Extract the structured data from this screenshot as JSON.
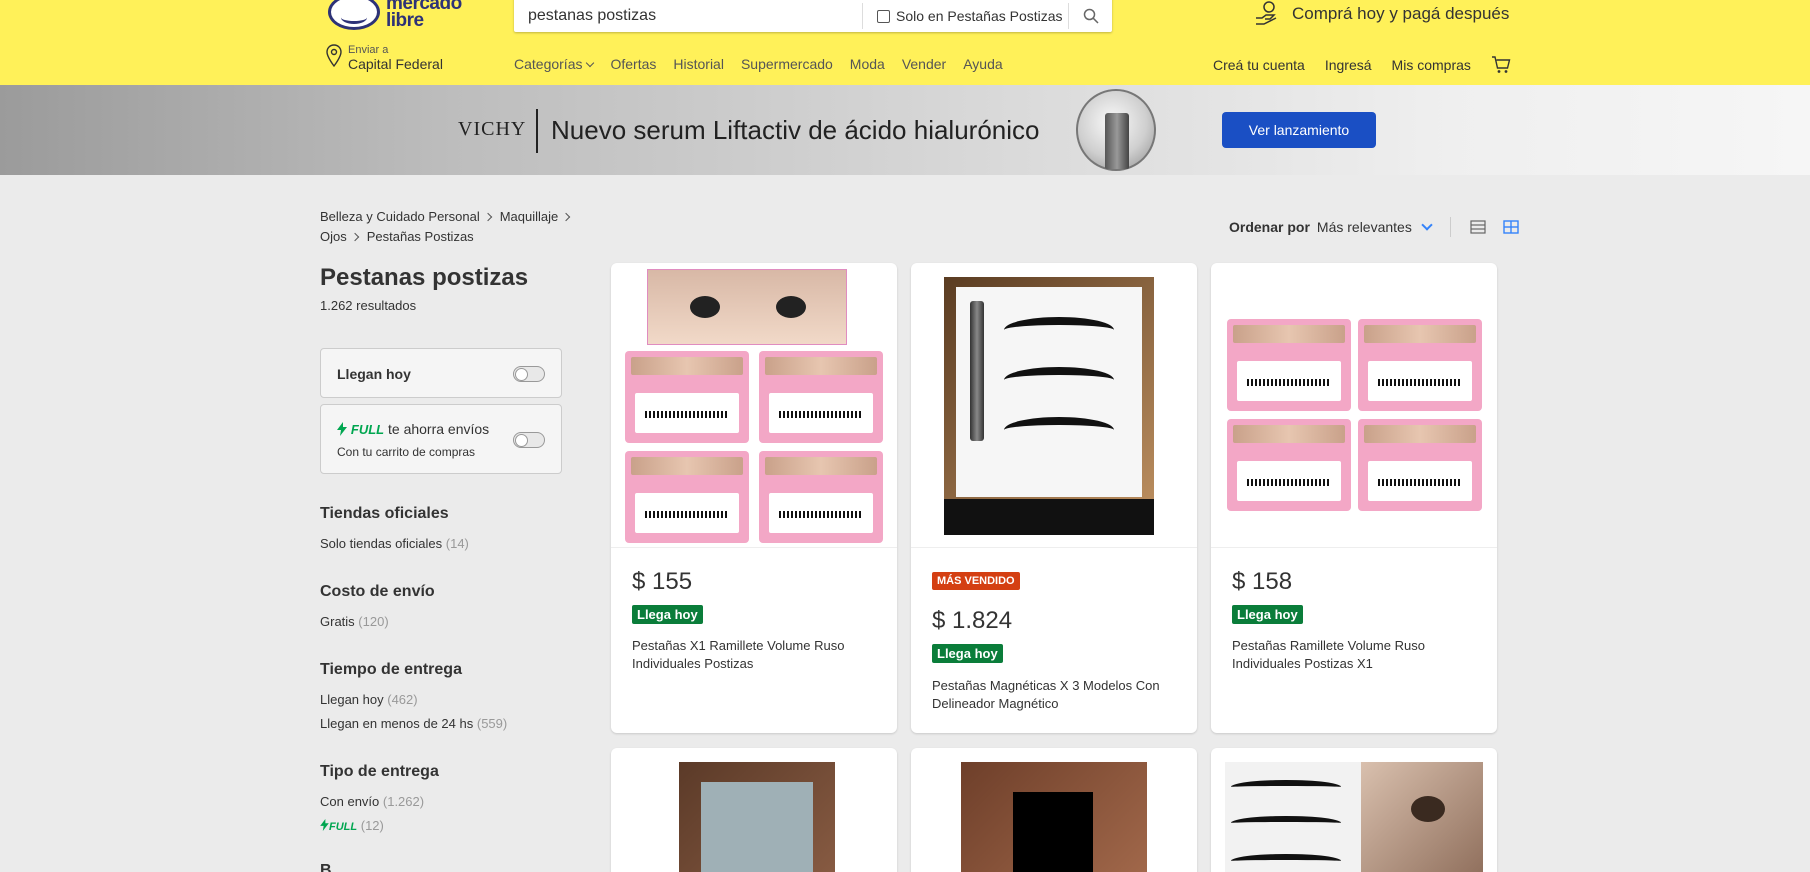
{
  "header": {
    "logo_line1": "mercado",
    "logo_line2": "libre",
    "search_value": "pestanas postizas",
    "search_scope_label": "Solo en Pestañas Postizas",
    "promo_text": "Comprá hoy y pagá después",
    "location_small": "Enviar a",
    "location_big": "Capital Federal",
    "nav": {
      "categories": "Categorías",
      "offers": "Ofertas",
      "history": "Historial",
      "supermarket": "Supermercado",
      "fashion": "Moda",
      "sell": "Vender",
      "help": "Ayuda"
    },
    "account": {
      "create": "Creá tu cuenta",
      "login": "Ingresá",
      "purchases": "Mis compras"
    }
  },
  "banner": {
    "brand": "VICHY",
    "text": "Nuevo serum Liftactiv de ácido hialurónico",
    "button": "Ver lanzamiento"
  },
  "breadcrumb": {
    "item1": "Belleza y Cuidado Personal",
    "item2": "Maquillaje",
    "item3": "Ojos",
    "item4": "Pestañas Postizas"
  },
  "sort": {
    "label": "Ordenar por",
    "value": "Más relevantes"
  },
  "sidebar": {
    "title": "Pestanas postizas",
    "count": "1.262 resultados",
    "today_label": "Llegan hoy",
    "full_badge": "FULL",
    "full_label": "te ahorra envíos",
    "full_sub": "Con tu carrito de compras",
    "official_h": "Tiendas oficiales",
    "official_item": "Solo tiendas oficiales",
    "official_count": "(14)",
    "shipping_h": "Costo de envío",
    "shipping_item": "Gratis",
    "shipping_count": "(120)",
    "time_h": "Tiempo de entrega",
    "time_item1": "Llegan hoy",
    "time_count1": "(462)",
    "time_item2": "Llegan en menos de 24 hs",
    "time_count2": "(559)",
    "type_h": "Tipo de entrega",
    "type_item1": "Con envío",
    "type_count1": "(1.262)",
    "type_full": "FULL",
    "type_count2": "(12)"
  },
  "products": [
    {
      "price": "$ 155",
      "badge": "Llega hoy",
      "name": "Pestañas X1 Ramillete Volume Ruso Individuales Postizas"
    },
    {
      "tag": "MÁS VENDIDO",
      "price": "$ 1.824",
      "badge": "Llega hoy",
      "name": "Pestañas Magnéticas X 3 Modelos Con Delineador Magnético"
    },
    {
      "price": "$ 158",
      "badge": "Llega hoy",
      "name": "Pestañas Ramillete Volume Ruso Individuales Postizas X1"
    }
  ],
  "colors": {
    "header_yellow": "#fff159",
    "accent_blue": "#3483fa",
    "green_badge": "#0a7d3a",
    "red_badge": "#d43f12"
  }
}
